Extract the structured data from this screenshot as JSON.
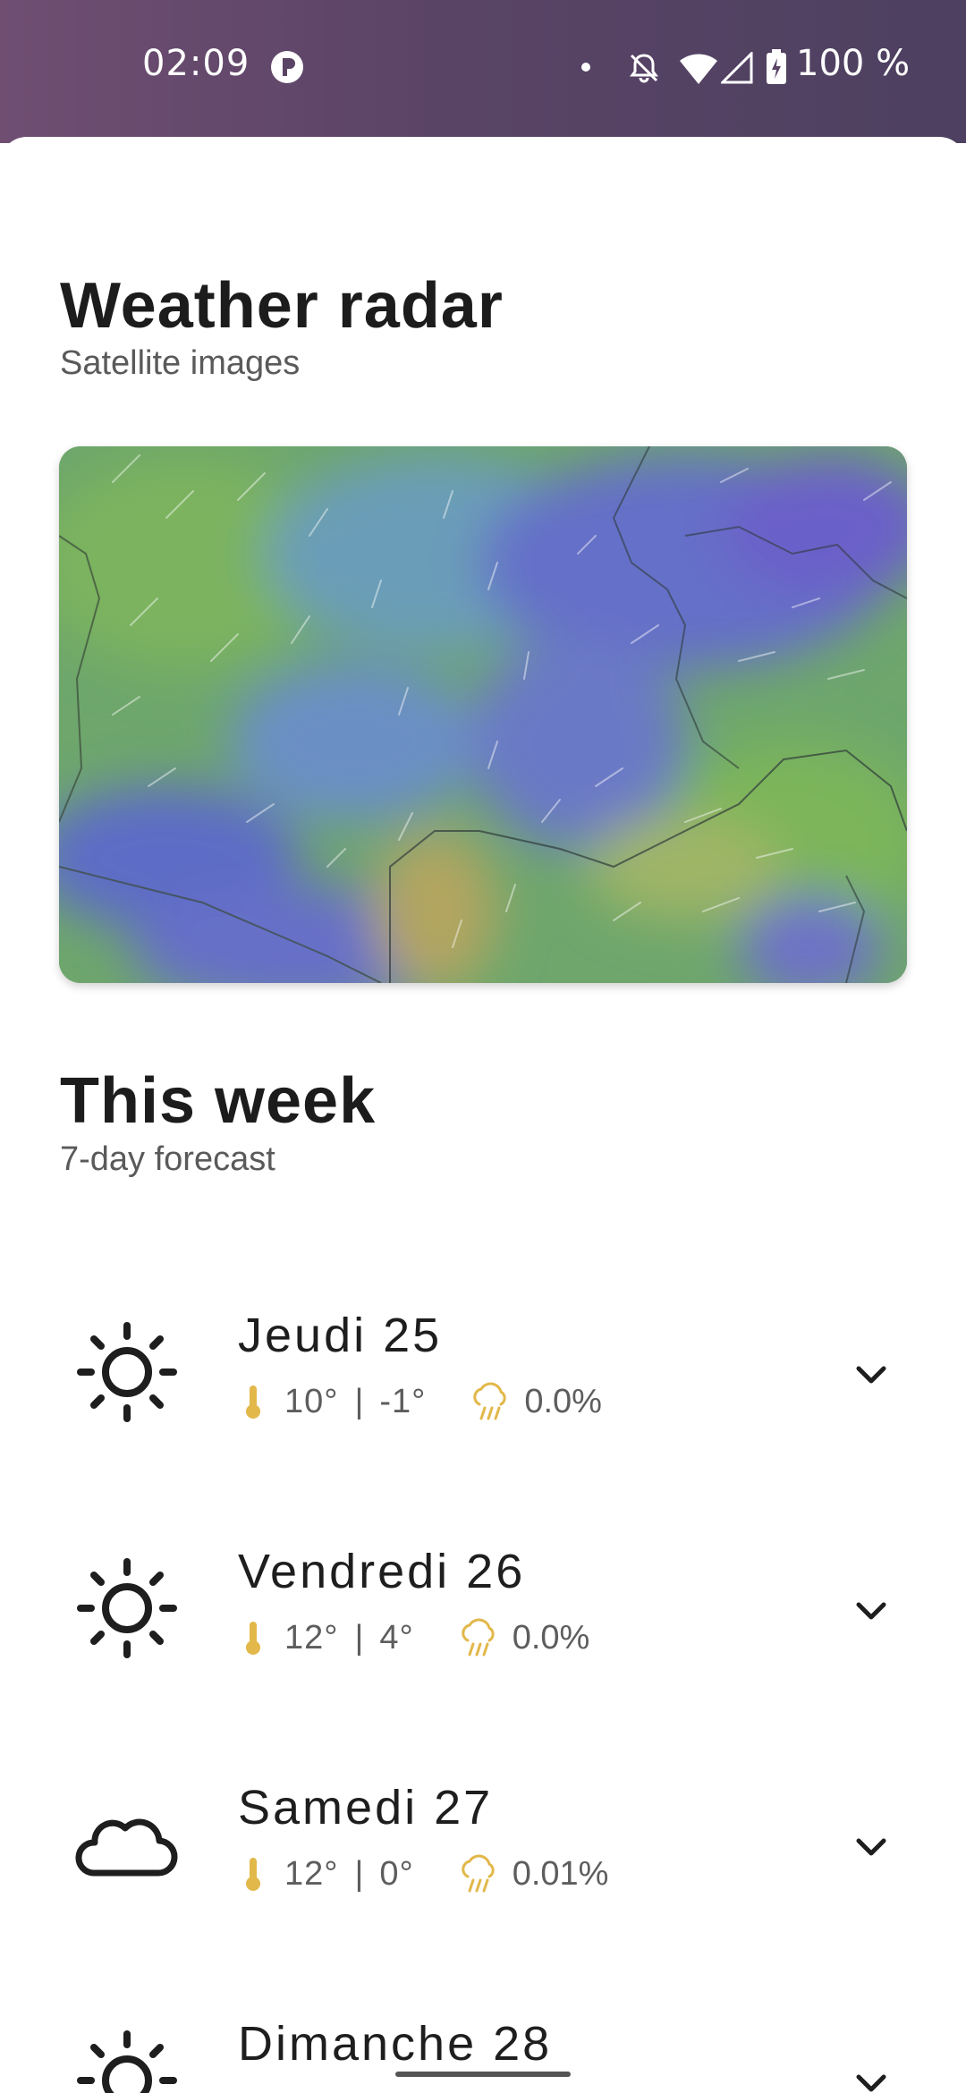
{
  "status_bar": {
    "time": "02:09",
    "battery_text": "100 %"
  },
  "radar": {
    "title": "Weather radar",
    "subtitle": "Satellite images"
  },
  "week": {
    "title": "This week",
    "subtitle": "7-day forecast",
    "days": [
      {
        "name": "Jeudi 25",
        "high": "10°",
        "low": "-1°",
        "rain": "0.0%",
        "icon": "sun-icon"
      },
      {
        "name": "Vendredi 26",
        "high": "12°",
        "low": "4°",
        "rain": "0.0%",
        "icon": "sun-icon"
      },
      {
        "name": "Samedi 27",
        "high": "12°",
        "low": "0°",
        "rain": "0.01%",
        "icon": "cloud-icon"
      },
      {
        "name": "Dimanche 28",
        "high": "",
        "low": "",
        "rain": "",
        "icon": "sun-icon"
      }
    ],
    "separator": "|"
  },
  "colors": {
    "accent": "#e2b84a",
    "title": "#1c1c1c",
    "subtitle": "#5a5a5a"
  }
}
